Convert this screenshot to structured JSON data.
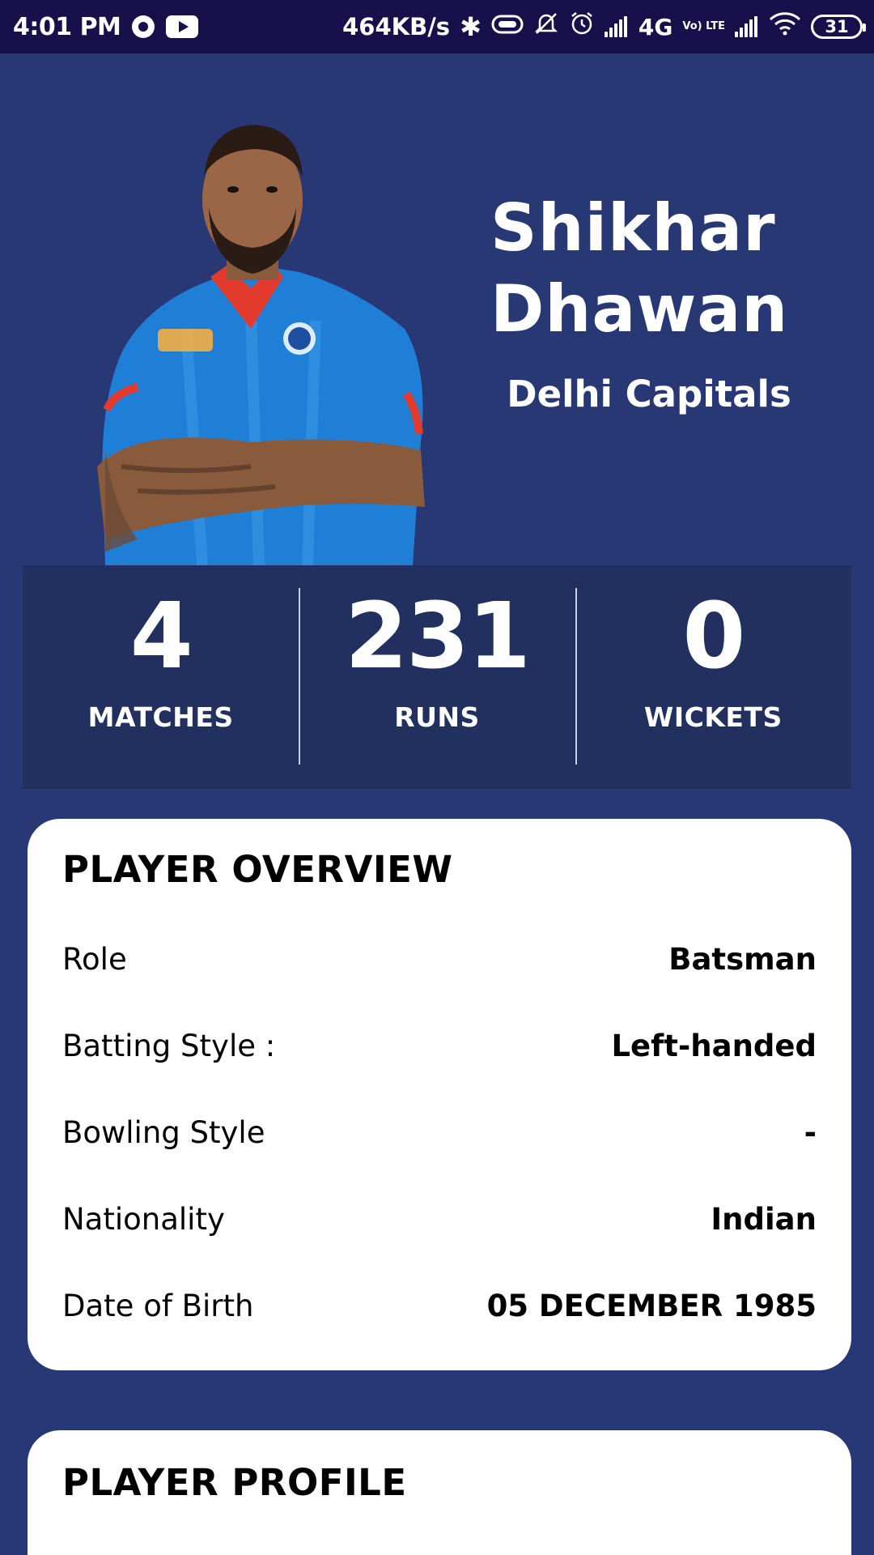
{
  "status_bar": {
    "time": "4:01 PM",
    "net_speed": "464KB/s",
    "network_type": "4G",
    "volte": "Vo) LTE",
    "battery": "31",
    "icons": [
      "notification-dot-icon",
      "youtube-icon",
      "bluetooth-icon",
      "vibrate-icon",
      "mute-icon",
      "alarm-icon",
      "signal-icon",
      "wifi-icon",
      "battery-icon"
    ]
  },
  "player": {
    "first_name": "Shikhar",
    "last_name": "Dhawan",
    "team": "Delhi Capitals",
    "jersey_color": "#1f7fd6",
    "accent_color": "#e23b2e"
  },
  "stats": [
    {
      "value": "4",
      "label": "MATCHES"
    },
    {
      "value": "231",
      "label": "RUNS"
    },
    {
      "value": "0",
      "label": "WICKETS"
    }
  ],
  "overview": {
    "title": "PLAYER OVERVIEW",
    "rows": [
      {
        "label": "Role",
        "value": "Batsman"
      },
      {
        "label": "Batting Style :",
        "value": "Left-handed"
      },
      {
        "label": "Bowling Style",
        "value": "-"
      },
      {
        "label": "Nationality",
        "value": "Indian"
      },
      {
        "label": "Date of Birth",
        "value": "05 DECEMBER 1985"
      }
    ]
  },
  "profile": {
    "title": "PLAYER PROFILE"
  },
  "colors": {
    "background": "#283874",
    "status_bar": "#17104a",
    "stats_panel": "#22305f",
    "card": "#ffffff"
  }
}
